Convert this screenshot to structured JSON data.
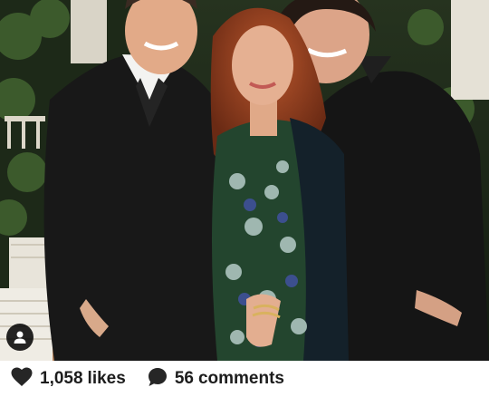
{
  "post": {
    "likes": {
      "count": "1,058",
      "label": "likes",
      "icon": "heart-icon"
    },
    "comments": {
      "count": "56",
      "label": "comments",
      "icon": "comment-bubble-icon"
    },
    "tag_icon": "user-tag-icon"
  },
  "colors": {
    "text": "#1c1c1c",
    "background": "#ffffff"
  }
}
